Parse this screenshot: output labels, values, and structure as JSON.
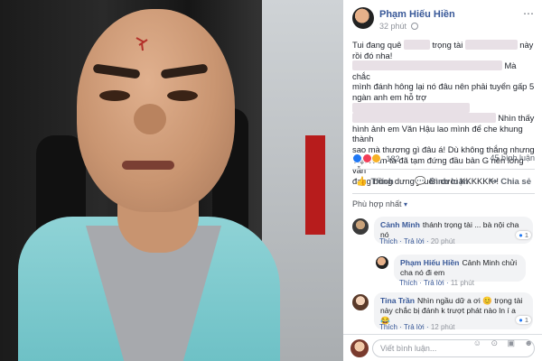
{
  "post": {
    "author": "Phạm Hiếu Hiền",
    "time": "32 phút",
    "more_icon": "⋯",
    "text_lines": [
      [
        "Tui đang quê",
        "▇▇▇▇",
        "trọng tài",
        "▇▇▇▇▇▇▇▇",
        "này rồi đó nha!"
      ],
      [
        "▇▇▇▇▇▇▇▇▇▇▇▇▇▇▇▇▇▇▇▇▇▇▇",
        "Mà chắc"
      ],
      [
        "mình đánh hông lại nó đâu nên phải tuyển gấp 5"
      ],
      [
        "ngàn anh em hỗ trợ",
        "▇▇▇▇▇▇▇▇▇▇▇▇▇▇▇▇▇▇"
      ],
      [
        "▇▇▇▇▇▇▇▇▇▇▇▇▇▇▇▇▇▇▇▇▇▇",
        "Nhìn thấy"
      ],
      [
        "hình ảnh em Văn Hậu lao mình để che khung thành"
      ],
      [
        "sao mà thương gì đâu á! Dù không thắng nhưng"
      ],
      [
        "Việt Nam ta đã tạm đứng đầu bản G nên lòng vẫn"
      ],
      [
        "đang bồng dưng muốn cười KKKKKK !"
      ]
    ]
  },
  "reactions": {
    "count": "182",
    "comments": "45 bình luận"
  },
  "actions": {
    "like": "Thích",
    "comment": "Bình luận",
    "share": "Chia sẻ"
  },
  "sort": {
    "label": "Phù hợp nhất",
    "caret": "▾"
  },
  "comments": [
    {
      "name": "Cảnh Minh",
      "text": "thánh trọng tài ... bà nội cha nó",
      "like": "Thích",
      "reply": "Trả lời",
      "time": "20 phút",
      "reaction_count": "1"
    },
    {
      "name": "Phạm Hiếu Hiền",
      "text": "Cảnh Minh chửi cha nó đi em",
      "like": "Thích",
      "reply": "Trả lời",
      "time": "11 phút"
    },
    {
      "name": "Tina Trần",
      "text": "Nhìn ngầu dữ a ơi 😊 trọng tài này chắc bị đánh k trượt phát nào ln í a 😂",
      "like": "Thích",
      "reply": "Trả lời",
      "time": "12 phút",
      "reaction_count": "1"
    }
  ],
  "composer": {
    "placeholder": "Viết bình luận...",
    "tools": "☺ ⊙ ▣ ☻"
  },
  "colors": {
    "link_blue": "#385898",
    "like_blue": "#2078f4",
    "heart_red": "#f33e58",
    "haha_yellow": "#f7b125"
  }
}
